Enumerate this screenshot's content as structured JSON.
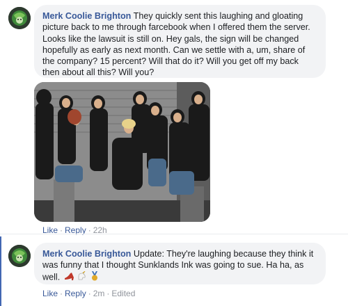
{
  "comments": [
    {
      "author": "Merk Coolie Brighton",
      "text": "They quickly sent this laughing and gloating picture back to me through farcebook when I offered them the server. Looks like the lawsuit is still on. Hey gals, the sign will be changed hopefully as early as next month. Can we settle with a, um, share of the company? 15 percent? Will that do it? Will you get off my back then about all this? Will you?",
      "actions": {
        "like": "Like",
        "separator": "·",
        "reply": "Reply",
        "time": "22h"
      }
    },
    {
      "author": "Merk Coolie Brighton",
      "text": "Update: They're laughing because they think it was funny that I thought Sunklands Ink was going to sue. Ha ha, as well.",
      "emoji_icons": [
        "high-heel-icon",
        "unicorn-icon",
        "medal-icon"
      ],
      "actions": {
        "like": "Like",
        "separator": "·",
        "reply": "Reply",
        "time": "2m",
        "edited": "Edited"
      }
    }
  ],
  "colors": {
    "author": "#385898",
    "bubble": "#f2f3f5",
    "meta_gray": "#90949c",
    "reply_line": "#4267b2"
  }
}
